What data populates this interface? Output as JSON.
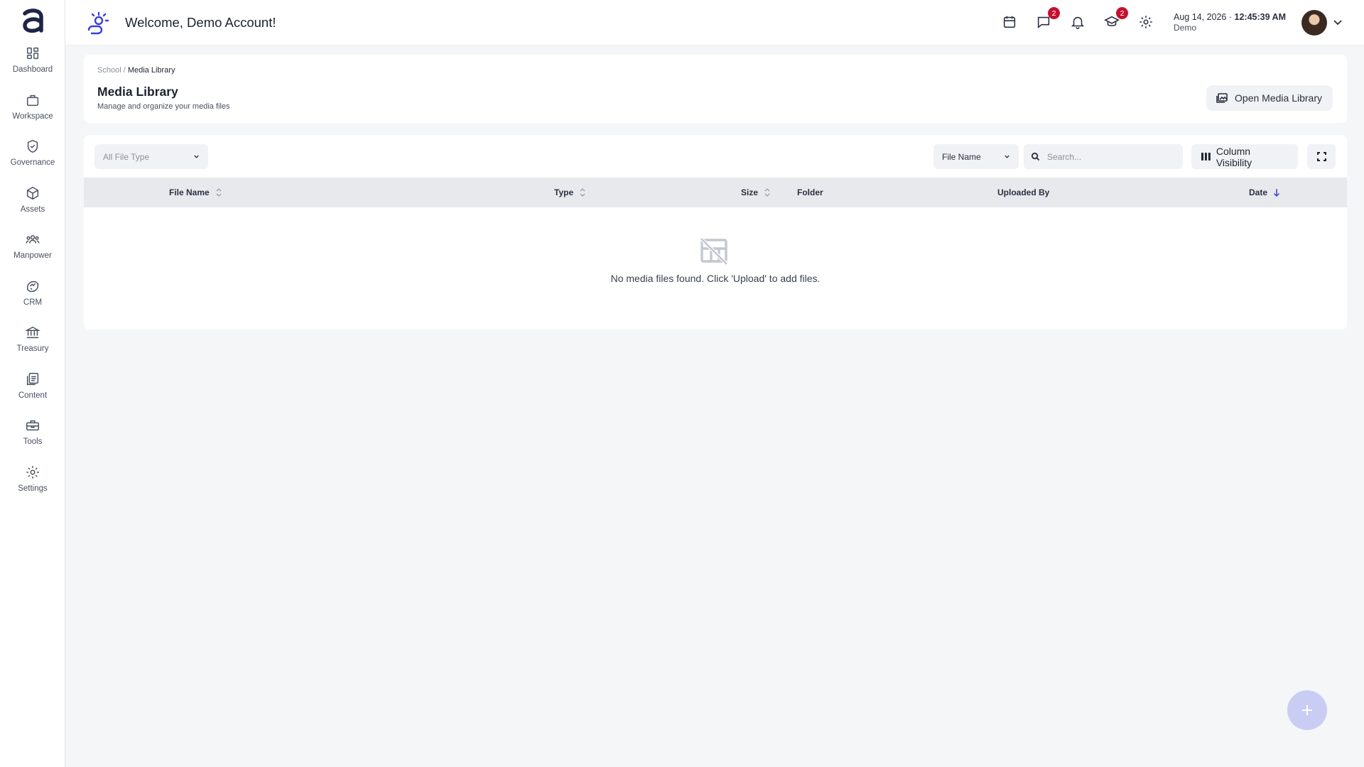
{
  "header": {
    "welcome": "Welcome, Demo Account!",
    "date": "Aug 14, 2026",
    "time": "12:45:39 AM",
    "account": "Demo",
    "messages_badge": "2",
    "learning_badge": "2",
    "accent_color": "#3b3fd8"
  },
  "sidebar": {
    "items": [
      {
        "label": "Dashboard",
        "icon": "dashboard-icon"
      },
      {
        "label": "Workspace",
        "icon": "briefcase-icon"
      },
      {
        "label": "Governance",
        "icon": "shield-check-icon"
      },
      {
        "label": "Assets",
        "icon": "cube-icon"
      },
      {
        "label": "Manpower",
        "icon": "people-icon"
      },
      {
        "label": "CRM",
        "icon": "handshake-icon"
      },
      {
        "label": "Treasury",
        "icon": "bank-icon"
      },
      {
        "label": "Content",
        "icon": "documents-icon"
      },
      {
        "label": "Tools",
        "icon": "toolbox-icon"
      },
      {
        "label": "Settings",
        "icon": "gear-icon"
      }
    ]
  },
  "page": {
    "breadcrumb_parent": "School",
    "breadcrumb_separator": "/",
    "breadcrumb_current": "Media Library",
    "title": "Media Library",
    "subtitle": "Manage and organize your media files",
    "open_library_label": "Open Media Library"
  },
  "toolbar": {
    "file_type_filter": "All File Type",
    "sort_field": "File Name",
    "search_placeholder": "Search...",
    "column_visibility_label": "Column Visibility"
  },
  "table": {
    "columns": [
      "File Name",
      "Type",
      "Size",
      "Folder",
      "Uploaded By",
      "Date"
    ],
    "empty_message": "No media files found. Click 'Upload' to add files."
  }
}
